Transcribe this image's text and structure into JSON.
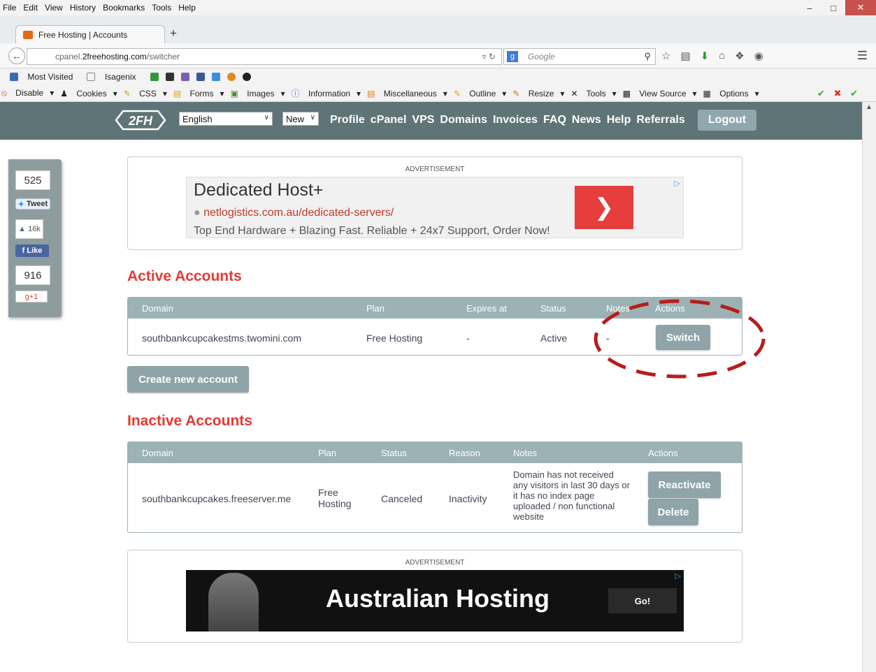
{
  "browser": {
    "menu": [
      "File",
      "Edit",
      "View",
      "History",
      "Bookmarks",
      "Tools",
      "Help"
    ],
    "tab_title": "Free Hosting | Accounts",
    "url_prefix": "cpanel.",
    "url_domain": "2freehosting.com",
    "url_path": "/switcher",
    "search_placeholder": "Google",
    "bookmarks": [
      "Most Visited",
      "Isagenix"
    ],
    "webdev_toolbar": [
      "Disable",
      "Cookies",
      "CSS",
      "Forms",
      "Images",
      "Information",
      "Miscellaneous",
      "Outline",
      "Resize",
      "Tools",
      "View Source",
      "Options"
    ]
  },
  "header": {
    "logo_text": "2FH",
    "language": "English",
    "new_select": "New",
    "nav": [
      "Profile",
      "cPanel",
      "VPS",
      "Domains",
      "Invoices",
      "FAQ",
      "News",
      "Help",
      "Referrals"
    ],
    "logout_label": "Logout"
  },
  "social": {
    "tweet_count": "525",
    "tweet_label": "Tweet",
    "fb_count": "16k",
    "like_label": "Like",
    "gplus_count": "916",
    "gplus_label": "g+1"
  },
  "ad_top": {
    "label": "ADVERTISEMENT",
    "title": "Dedicated Host+",
    "url": "netlogistics.com.au/dedicated-servers/",
    "desc": "Top End Hardware + Blazing Fast. Reliable + 24x7 Support, Order Now!"
  },
  "active": {
    "title": "Active Accounts",
    "headers": [
      "Domain",
      "Plan",
      "Expires at",
      "Status",
      "Notes",
      "Actions"
    ],
    "row": {
      "domain": "southbankcupcakestms.twomini.com",
      "plan": "Free Hosting",
      "expires": "-",
      "status": "Active",
      "notes": "-",
      "action": "Switch"
    },
    "create_label": "Create new account"
  },
  "inactive": {
    "title": "Inactive Accounts",
    "headers": [
      "Domain",
      "Plan",
      "Status",
      "Reason",
      "Notes",
      "Actions"
    ],
    "row": {
      "domain": "southbankcupcakes.freeserver.me",
      "plan": "Free Hosting",
      "status": "Canceled",
      "reason": "Inactivity",
      "notes": "Domain has not received any visitors in last 30 days or it has no index page uploaded / non functional website",
      "reactivate": "Reactivate",
      "delete": "Delete"
    }
  },
  "ad_bottom": {
    "label": "ADVERTISEMENT",
    "title": "Australian Hosting",
    "cta": "Go!"
  },
  "colors": {
    "header_bg": "#5f7476",
    "table_head": "#9db2b5",
    "button": "#8ea4a8",
    "section_title": "#e53935",
    "annotation": "#b71c1c"
  }
}
